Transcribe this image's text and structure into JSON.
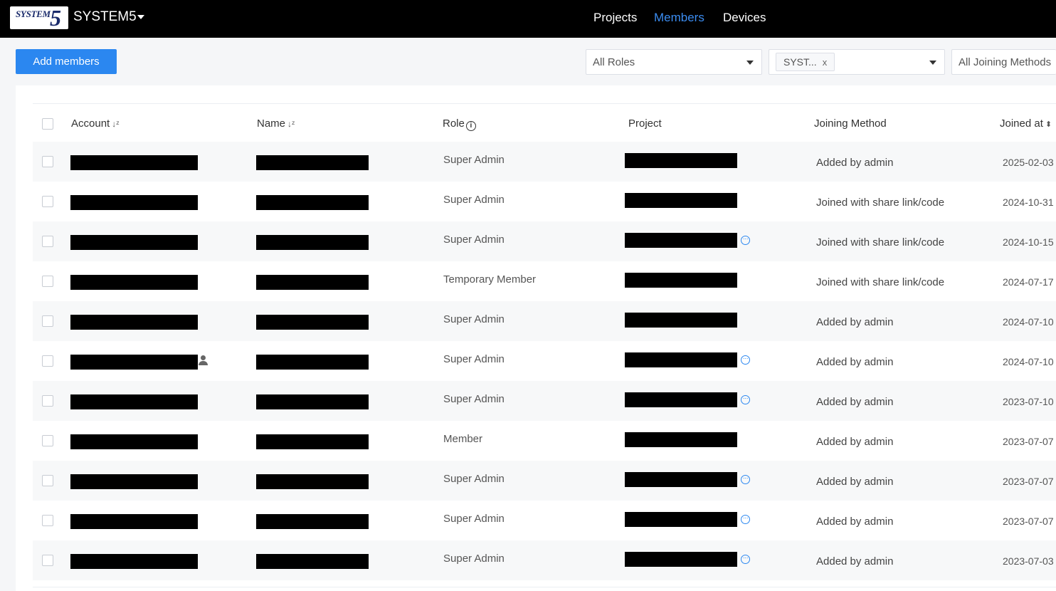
{
  "header": {
    "logo_top": "SYSTEM",
    "logo_num": "5",
    "org_name": "SYSTEM5",
    "nav": [
      {
        "label": "Projects",
        "active": false
      },
      {
        "label": "Members",
        "active": true
      },
      {
        "label": "Devices",
        "active": false
      }
    ]
  },
  "toolbar": {
    "add_label": "Add members",
    "roles_value": "All Roles",
    "project_tag": "SYST...",
    "tag_remove": "x",
    "methods_value": "All Joining Methods"
  },
  "table": {
    "columns": {
      "account": "Account",
      "name": "Name",
      "role": "Role",
      "project": "Project",
      "method": "Joining Method",
      "joined": "Joined at"
    },
    "rows": [
      {
        "role": "Super Admin",
        "method": "Added by admin",
        "joined": "2025-02-03",
        "more": false,
        "user_icon": false
      },
      {
        "role": "Super Admin",
        "method": "Joined with share link/code",
        "joined": "2024-10-31",
        "more": false,
        "user_icon": false
      },
      {
        "role": "Super Admin",
        "method": "Joined with share link/code",
        "joined": "2024-10-15",
        "more": true,
        "user_icon": false
      },
      {
        "role": "Temporary Member",
        "method": "Joined with share link/code",
        "joined": "2024-07-17",
        "more": false,
        "user_icon": false
      },
      {
        "role": "Super Admin",
        "method": "Added by admin",
        "joined": "2024-07-10",
        "more": false,
        "user_icon": false
      },
      {
        "role": "Super Admin",
        "method": "Added by admin",
        "joined": "2024-07-10",
        "more": true,
        "user_icon": true
      },
      {
        "role": "Super Admin",
        "method": "Added by admin",
        "joined": "2023-07-10",
        "more": true,
        "user_icon": false
      },
      {
        "role": "Member",
        "method": "Added by admin",
        "joined": "2023-07-07",
        "more": false,
        "user_icon": false
      },
      {
        "role": "Super Admin",
        "method": "Added by admin",
        "joined": "2023-07-07",
        "more": true,
        "user_icon": false
      },
      {
        "role": "Super Admin",
        "method": "Added by admin",
        "joined": "2023-07-07",
        "more": true,
        "user_icon": false
      },
      {
        "role": "Super Admin",
        "method": "Added by admin",
        "joined": "2023-07-03",
        "more": true,
        "user_icon": false
      }
    ]
  },
  "colors": {
    "accent": "#2b87f0",
    "header_bg": "#000000"
  }
}
